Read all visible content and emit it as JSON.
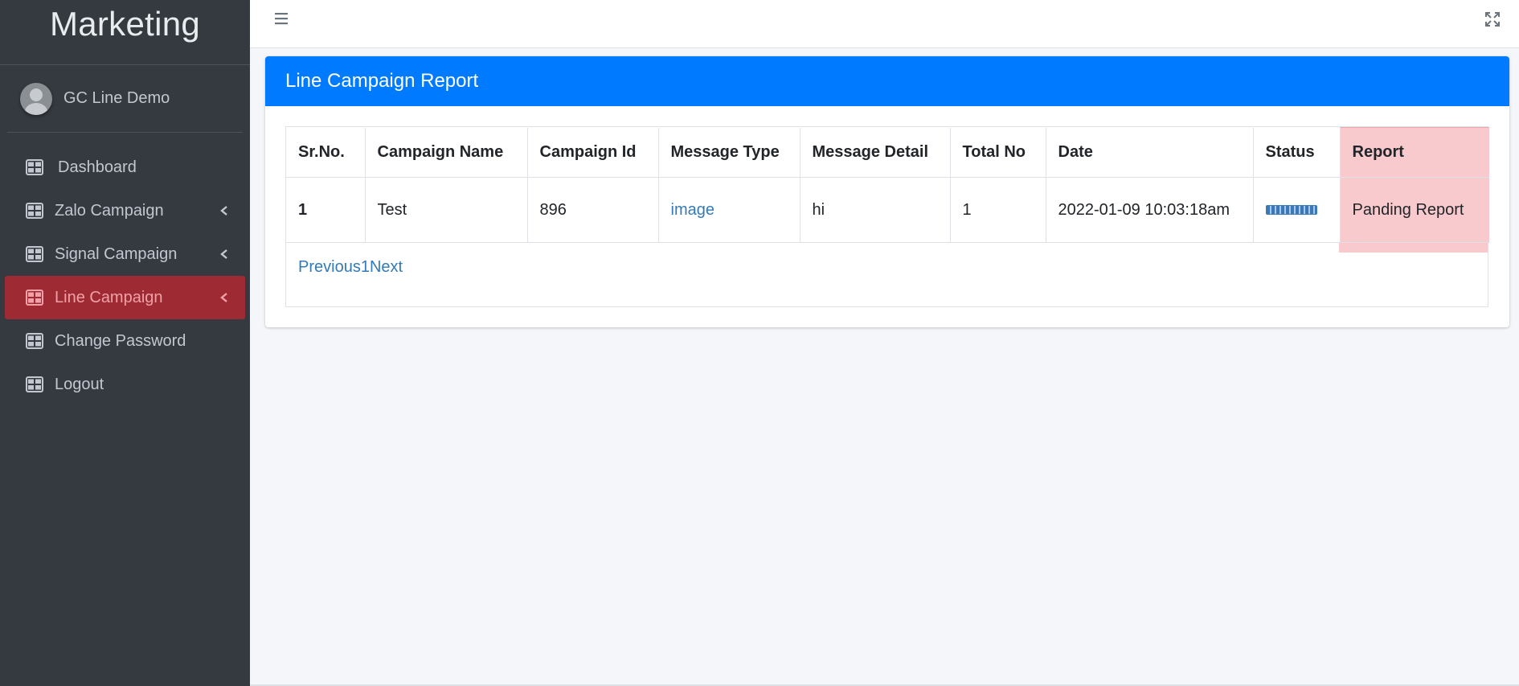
{
  "brand": {
    "title": "Marketing"
  },
  "user": {
    "name": "GC Line Demo"
  },
  "sidebar": {
    "items": [
      {
        "label": "Dashboard",
        "icon": "table-icon",
        "has_caret": false,
        "active": false
      },
      {
        "label": "Zalo Campaign",
        "icon": "table-icon",
        "has_caret": true,
        "active": false
      },
      {
        "label": "Signal Campaign",
        "icon": "table-icon",
        "has_caret": true,
        "active": false
      },
      {
        "label": "Line Campaign",
        "icon": "table-icon",
        "has_caret": true,
        "active": true
      },
      {
        "label": "Change Password",
        "icon": "table-icon",
        "has_caret": false,
        "active": false
      },
      {
        "label": "Logout",
        "icon": "table-icon",
        "has_caret": false,
        "active": false
      }
    ]
  },
  "topbar": {
    "menu_icon": "hamburger-icon",
    "expand_icon": "expand-icon"
  },
  "card": {
    "title": "Line Campaign Report",
    "header_color": "#007bff"
  },
  "table": {
    "headers": [
      "Sr.No.",
      "Campaign Name",
      "Campaign Id",
      "Message Type",
      "Message Detail",
      "Total No",
      "Date",
      "Status",
      "Report"
    ],
    "rows": [
      {
        "sr_no": "1",
        "campaign_name": "Test",
        "campaign_id": "896",
        "message_type": "image",
        "message_detail": "hi",
        "total_no": "1",
        "date": "2022-01-09 10:03:18am",
        "status": "progress-bar",
        "report": "Panding Report"
      }
    ]
  },
  "pagination": {
    "previous": "Previous",
    "page": "1",
    "next": "Next"
  },
  "colors": {
    "sidebar_bg": "#343a40",
    "active_bg": "#9e2b33",
    "report_bg": "#f8c9cd",
    "link": "#337ab7"
  }
}
